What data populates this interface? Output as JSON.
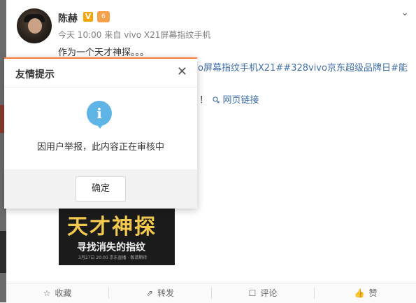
{
  "post": {
    "author": "陈赫",
    "verified_badge": "V",
    "level_badge": "6",
    "time": "今天 10:00",
    "source": "来自 vivo X21屏幕指纹手机",
    "text_line1": "作为一个天才神探。。。",
    "hashtag_line": "o屏幕指纹手机X21##328vivo京东超级品牌日#能",
    "text_fragment": "！",
    "link_label": "网页链接",
    "poster": {
      "title": "天才神探",
      "subtitle": "寻找消失的指纹",
      "caption": "3月27日 20:00 京东直播 · 敬请期待"
    }
  },
  "actions": [
    {
      "icon": "star-icon",
      "glyph": "☆",
      "label": "收藏"
    },
    {
      "icon": "share-icon",
      "glyph": "⇗",
      "label": "转发"
    },
    {
      "icon": "comment-icon",
      "glyph": "☐",
      "label": "评论"
    },
    {
      "icon": "like-icon",
      "glyph": "👍",
      "label": "赞"
    }
  ],
  "modal": {
    "title": "友情提示",
    "close_glyph": "✕",
    "icon_glyph": "i",
    "message": "因用户举报，此内容正在审核中",
    "ok_label": "确定"
  },
  "colors": {
    "accent": "#fa7d3c",
    "link": "#3f6ea8",
    "info": "#5fb4e6"
  }
}
